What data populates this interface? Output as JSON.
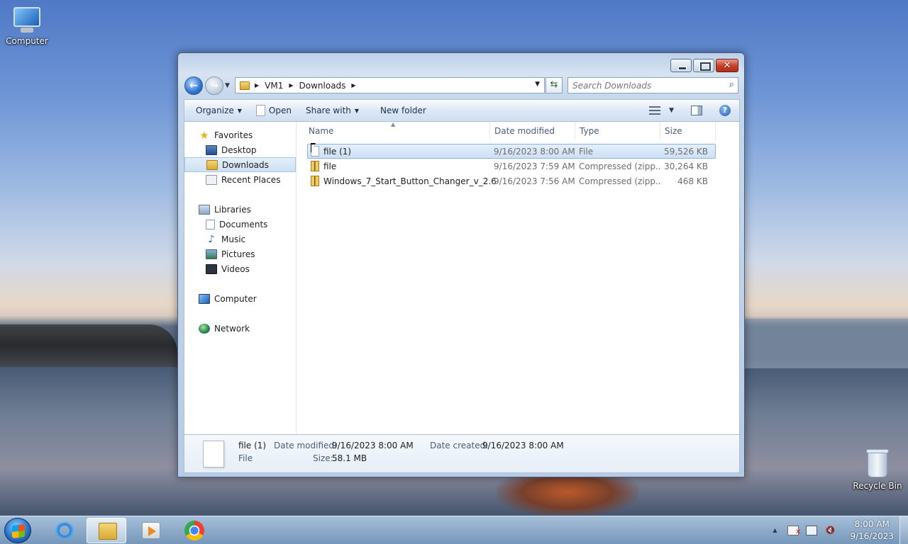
{
  "desktop": {
    "icons": [
      {
        "label": "Computer"
      },
      {
        "label": "Recycle Bin"
      }
    ]
  },
  "window": {
    "controls": {
      "close": "✕"
    },
    "address": {
      "crumbs": [
        "VM1",
        "Downloads"
      ]
    },
    "search": {
      "placeholder": "Search Downloads"
    },
    "toolbar": {
      "organize": "Organize",
      "open": "Open",
      "share_with": "Share with",
      "new_folder": "New folder"
    },
    "nav_pane": {
      "favorites": "Favorites",
      "desktop": "Desktop",
      "downloads": "Downloads",
      "recent_places": "Recent Places",
      "libraries": "Libraries",
      "documents": "Documents",
      "music": "Music",
      "pictures": "Pictures",
      "videos": "Videos",
      "computer": "Computer",
      "network": "Network"
    },
    "columns": {
      "name": "Name",
      "date_modified": "Date modified",
      "type": "Type",
      "size": "Size"
    },
    "files": [
      {
        "name": "file (1)",
        "date": "9/16/2023 8:00 AM",
        "type": "File",
        "size": "59,526 KB",
        "icon": "blank-file-icon"
      },
      {
        "name": "file",
        "date": "9/16/2023 7:59 AM",
        "type": "Compressed (zipp...",
        "size": "30,264 KB",
        "icon": "zip-folder-icon"
      },
      {
        "name": "Windows_7_Start_Button_Changer_v_2.6",
        "date": "9/16/2023 7:56 AM",
        "type": "Compressed (zipp...",
        "size": "468 KB",
        "icon": "zip-folder-icon"
      }
    ],
    "details": {
      "name": "file (1)",
      "kind": "File",
      "date_modified_label": "Date modified:",
      "date_modified": "9/16/2023 8:00 AM",
      "date_created_label": "Date created:",
      "date_created": "9/16/2023 8:00 AM",
      "size_label": "Size:",
      "size": "58.1 MB"
    }
  },
  "taskbar": {
    "clock_time": "8:00 AM",
    "clock_date": "9/16/2023",
    "tray_up": "▲",
    "apps": [
      "internet-explorer",
      "windows-explorer",
      "windows-media-player",
      "google-chrome"
    ]
  }
}
